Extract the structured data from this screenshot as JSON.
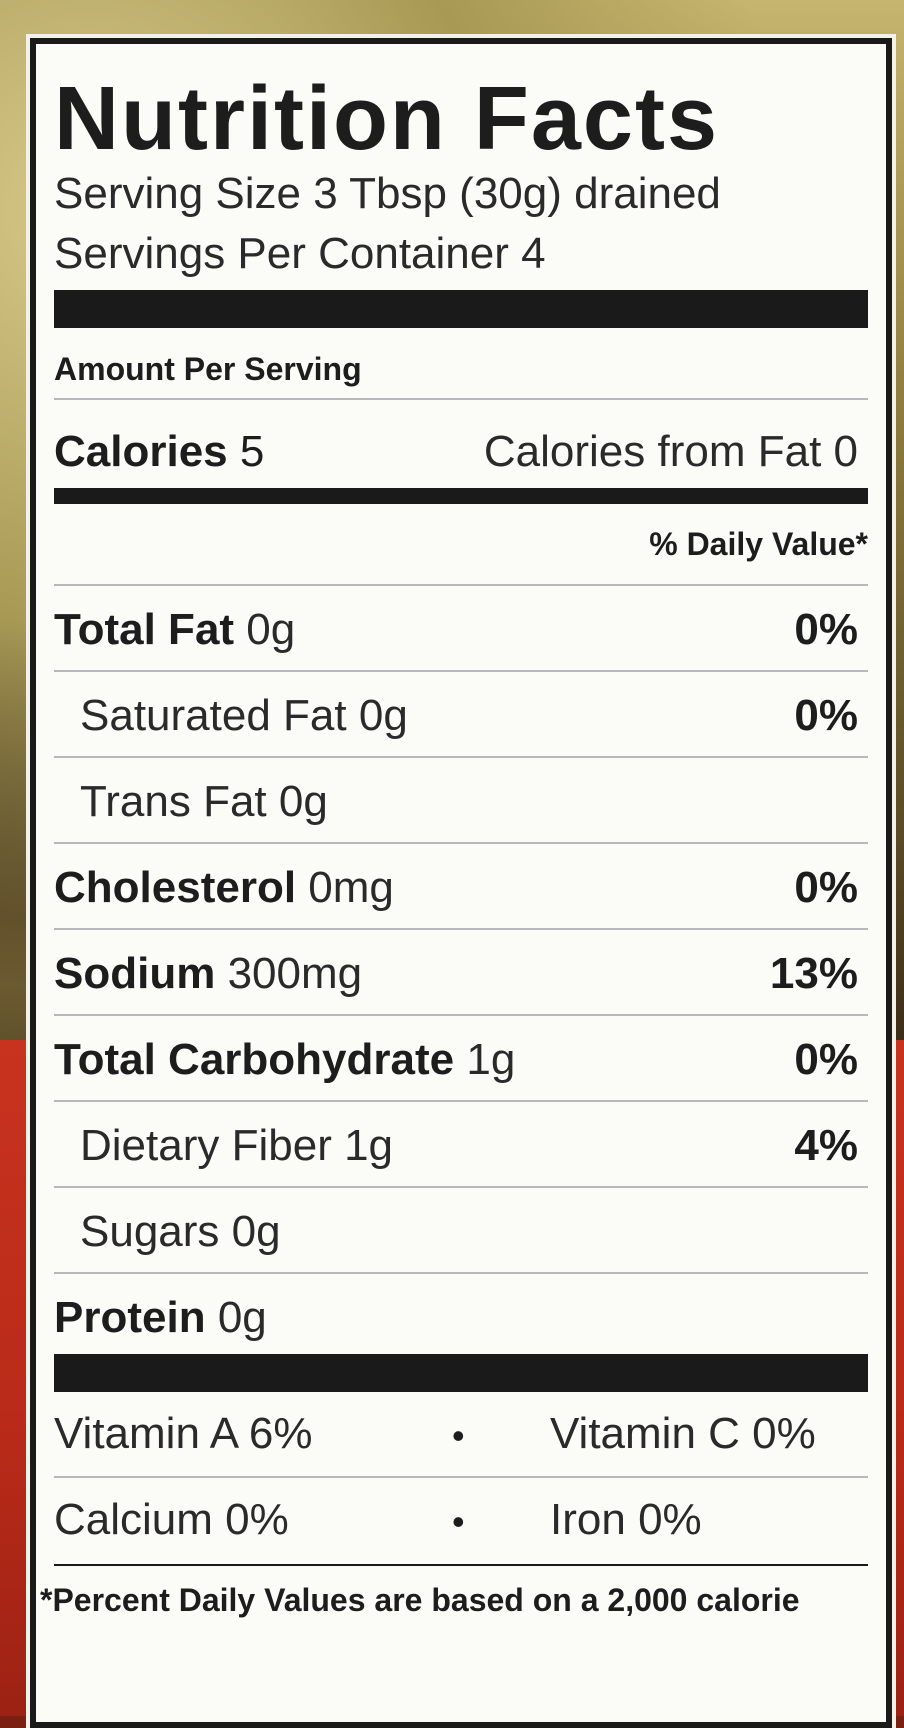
{
  "title": "Nutrition Facts",
  "serving_size": "Serving Size 3 Tbsp (30g) drained",
  "servings_per_container": "Servings Per Container 4",
  "amount_per_serving": "Amount Per Serving",
  "calories": {
    "label": "Calories",
    "value": "5",
    "from_fat": "Calories from Fat 0"
  },
  "daily_value_header": "% Daily Value*",
  "nutrients": [
    {
      "label": "Total Fat",
      "amount": "0g",
      "dv": "0%"
    },
    {
      "label": "Saturated Fat",
      "amount": "0g",
      "dv": "0%"
    },
    {
      "label": "Trans Fat",
      "amount": "0g",
      "dv": ""
    },
    {
      "label": "Cholesterol",
      "amount": "0mg",
      "dv": "0%"
    },
    {
      "label": "Sodium",
      "amount": "300mg",
      "dv": "13%"
    },
    {
      "label": "Total Carbohydrate",
      "amount": "1g",
      "dv": "0%"
    },
    {
      "label": "Dietary Fiber",
      "amount": "1g",
      "dv": "4%"
    },
    {
      "label": "Sugars",
      "amount": "0g",
      "dv": ""
    },
    {
      "label": "Protein",
      "amount": "0g",
      "dv": ""
    }
  ],
  "vitamins": [
    {
      "left_label": "Vitamin A",
      "left_value": "6%",
      "right_label": "Vitamin C",
      "right_value": "0%"
    },
    {
      "left_label": "Calcium",
      "left_value": "0%",
      "right_label": "Iron",
      "right_value": "0%"
    }
  ],
  "footnote": "*Percent Daily Values are based on a 2,000 calorie"
}
